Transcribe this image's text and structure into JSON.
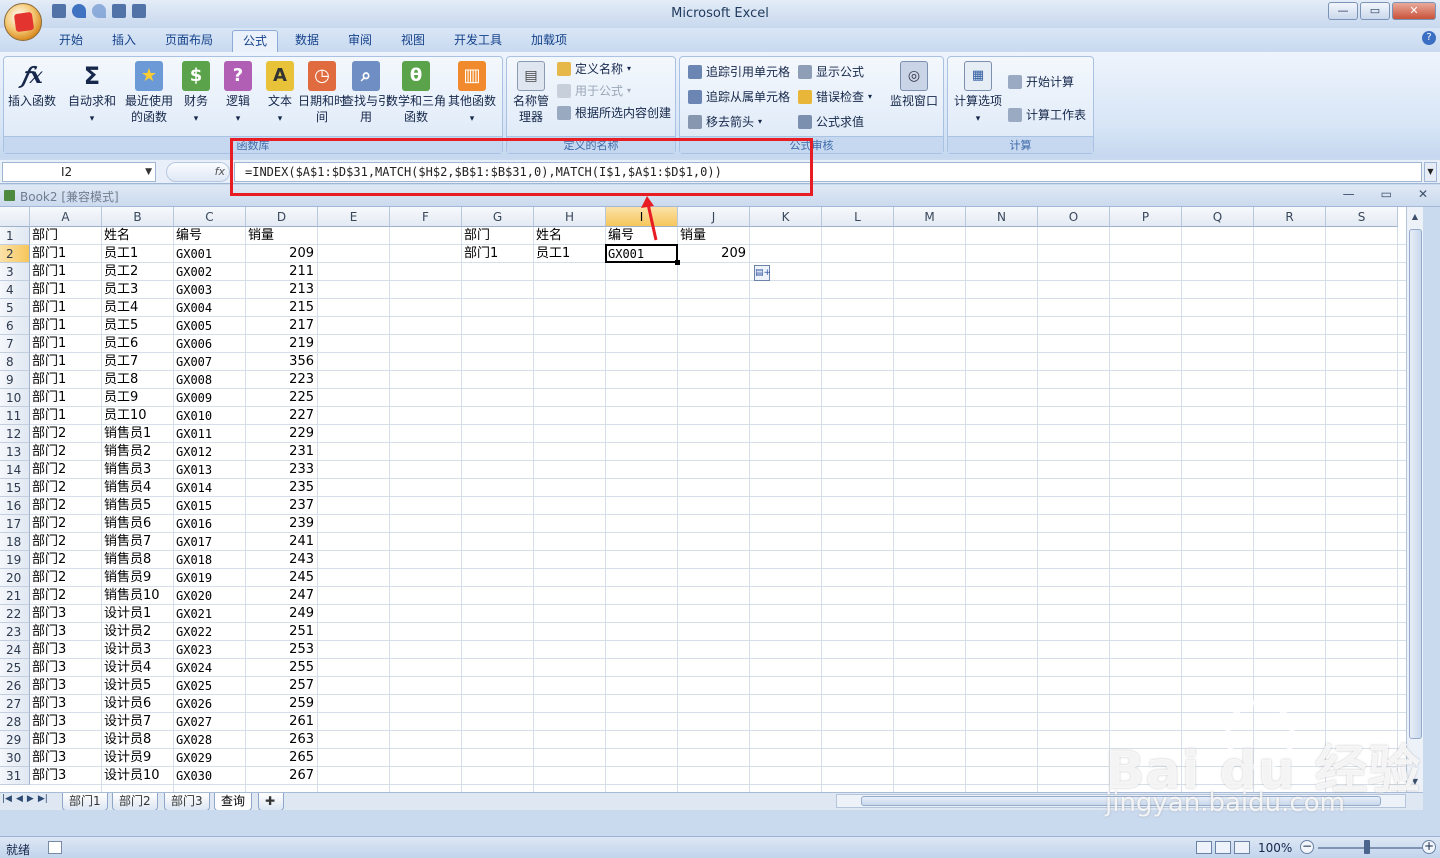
{
  "app": {
    "title": "Microsoft Excel",
    "help_label": "?"
  },
  "window": {
    "minimize": "—",
    "restore": "▭",
    "close": "✕"
  },
  "ribbon_tabs": [
    "开始",
    "插入",
    "页面布局",
    "公式",
    "数据",
    "审阅",
    "视图",
    "开发工具",
    "加载项"
  ],
  "active_tab": "公式",
  "ribbon": {
    "func_lib": {
      "label": "函数库",
      "insert_function": "插入函数",
      "autosum": "自动求和",
      "recent": "最近使用的函数",
      "financial": "财务",
      "logical": "逻辑",
      "text": "文本",
      "datetime": "日期和时间",
      "lookup": "查找与引用",
      "math": "数学和三角函数",
      "more": "其他函数"
    },
    "defined_names": {
      "label": "定义的名称",
      "name_manager": "名称管理器",
      "define_name": "定义名称",
      "use_in_formula": "用于公式",
      "create_from_selection": "根据所选内容创建"
    },
    "auditing": {
      "label": "公式审核",
      "trace_precedents": "追踪引用单元格",
      "trace_dependents": "追踪从属单元格",
      "remove_arrows": "移去箭头",
      "show_formulas": "显示公式",
      "error_checking": "错误检查",
      "evaluate": "公式求值",
      "watch_window": "监视窗口"
    },
    "calculation": {
      "label": "计算",
      "options": "计算选项",
      "calc_now": "开始计算",
      "calc_sheet": "计算工作表"
    }
  },
  "formula_bar": {
    "name_box": "I2",
    "fx": "fx",
    "formula": "=INDEX($A$1:$D$31,MATCH($H$2,$B$1:$B$31,0),MATCH(I$1,$A$1:$D$1,0))"
  },
  "workbook": {
    "title": "Book2  [兼容模式]"
  },
  "columns": [
    "A",
    "B",
    "C",
    "D",
    "E",
    "F",
    "G",
    "H",
    "I",
    "J",
    "K",
    "L",
    "M",
    "N",
    "O",
    "P",
    "Q",
    "R",
    "S"
  ],
  "selected_column": "I",
  "selected_row": 2,
  "table": {
    "headers": [
      "部门",
      "姓名",
      "编号",
      "销量"
    ],
    "rows": [
      [
        "部门1",
        "员工1",
        "GX001",
        "209"
      ],
      [
        "部门1",
        "员工2",
        "GX002",
        "211"
      ],
      [
        "部门1",
        "员工3",
        "GX003",
        "213"
      ],
      [
        "部门1",
        "员工4",
        "GX004",
        "215"
      ],
      [
        "部门1",
        "员工5",
        "GX005",
        "217"
      ],
      [
        "部门1",
        "员工6",
        "GX006",
        "219"
      ],
      [
        "部门1",
        "员工7",
        "GX007",
        "356"
      ],
      [
        "部门1",
        "员工8",
        "GX008",
        "223"
      ],
      [
        "部门1",
        "员工9",
        "GX009",
        "225"
      ],
      [
        "部门1",
        "员工10",
        "GX010",
        "227"
      ],
      [
        "部门2",
        "销售员1",
        "GX011",
        "229"
      ],
      [
        "部门2",
        "销售员2",
        "GX012",
        "231"
      ],
      [
        "部门2",
        "销售员3",
        "GX013",
        "233"
      ],
      [
        "部门2",
        "销售员4",
        "GX014",
        "235"
      ],
      [
        "部门2",
        "销售员5",
        "GX015",
        "237"
      ],
      [
        "部门2",
        "销售员6",
        "GX016",
        "239"
      ],
      [
        "部门2",
        "销售员7",
        "GX017",
        "241"
      ],
      [
        "部门2",
        "销售员8",
        "GX018",
        "243"
      ],
      [
        "部门2",
        "销售员9",
        "GX019",
        "245"
      ],
      [
        "部门2",
        "销售员10",
        "GX020",
        "247"
      ],
      [
        "部门3",
        "设计员1",
        "GX021",
        "249"
      ],
      [
        "部门3",
        "设计员2",
        "GX022",
        "251"
      ],
      [
        "部门3",
        "设计员3",
        "GX023",
        "253"
      ],
      [
        "部门3",
        "设计员4",
        "GX024",
        "255"
      ],
      [
        "部门3",
        "设计员5",
        "GX025",
        "257"
      ],
      [
        "部门3",
        "设计员6",
        "GX026",
        "259"
      ],
      [
        "部门3",
        "设计员7",
        "GX027",
        "261"
      ],
      [
        "部门3",
        "设计员8",
        "GX028",
        "263"
      ],
      [
        "部门3",
        "设计员9",
        "GX029",
        "265"
      ],
      [
        "部门3",
        "设计员10",
        "GX030",
        "267"
      ]
    ]
  },
  "lookup": {
    "headers": [
      "部门",
      "姓名",
      "编号",
      "销量"
    ],
    "values": [
      "部门1",
      "员工1",
      "GX001",
      "209"
    ]
  },
  "sheets": [
    "部门1",
    "部门2",
    "部门3",
    "查询"
  ],
  "active_sheet": "查询",
  "status": {
    "ready": "就绪",
    "zoom": "100%"
  },
  "watermark": {
    "logo": "Bai du 经验",
    "url": "jingyan.baidu.com"
  },
  "colors": {
    "highlight": "#e81c23",
    "selection": "#f6c65a"
  }
}
